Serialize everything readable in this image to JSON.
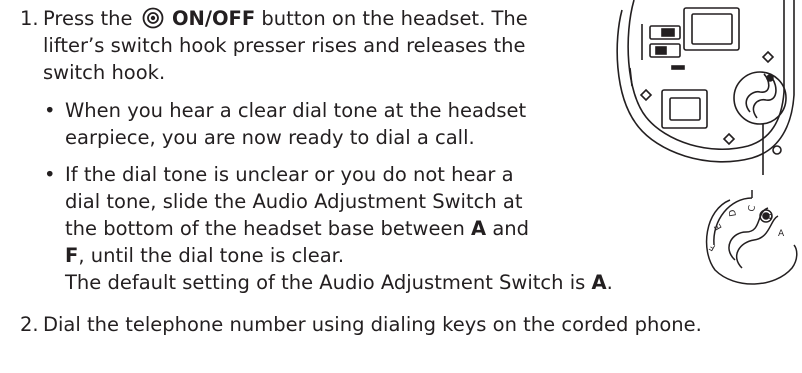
{
  "step1": {
    "number": "1.",
    "pre": "Press the",
    "button_name": "ON/OFF",
    "post": "button on the headset. The",
    "line2": "lifter’s switch hook presser rises and releases the",
    "line3": "switch hook.",
    "bullet_char": "•",
    "bullet1": {
      "line1": "When you hear a clear dial tone at the headset",
      "line2": "earpiece, you are now ready to dial a call."
    },
    "bullet2": {
      "line1": "If the dial tone is unclear or you do not hear a",
      "line2": "dial tone, slide the Audio Adjustment Switch at",
      "line3_pre": "the bottom of the headset base between",
      "letter_a": "A",
      "line3_and": "and",
      "letter_f": "F",
      "line4_post": ", until the dial tone is clear.",
      "line5_pre": "The default setting of the Audio Adjustment Switch is",
      "default_letter": "A",
      "line5_end": "."
    }
  },
  "step2": {
    "number": "2.",
    "text": "Dial the telephone number using dialing keys on the corded phone."
  },
  "illustration": {
    "dial_letters": [
      "A",
      "B",
      "C",
      "D",
      "E",
      "F"
    ],
    "icon": "power-button-icon",
    "stroke_color": "#231f20"
  }
}
